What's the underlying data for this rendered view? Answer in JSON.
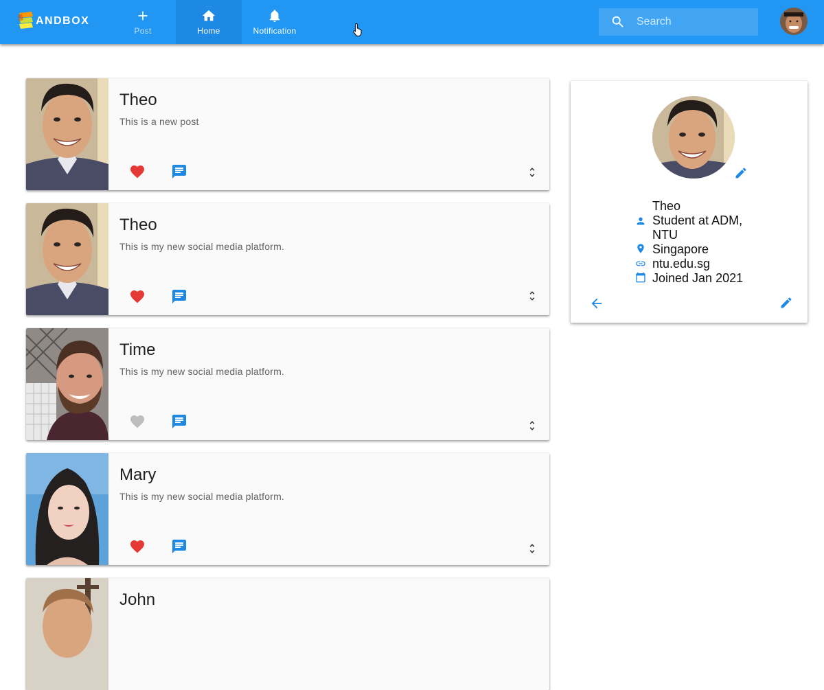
{
  "app": {
    "logo_text": "ANDBOX",
    "nav": [
      {
        "label": "Post",
        "icon": "plus-icon"
      },
      {
        "label": "Home",
        "icon": "home-icon",
        "active": true
      },
      {
        "label": "Notification",
        "icon": "bell-icon"
      }
    ],
    "search": {
      "placeholder": "Search"
    },
    "colors": {
      "primary": "#2196f3",
      "active_tab": "#1e88e5",
      "like": "#e53935",
      "like_off": "#bdbdbd"
    }
  },
  "posts": [
    {
      "name": "Theo",
      "text": "This is a new post",
      "liked": true
    },
    {
      "name": "Theo",
      "text": "This is my new social media platform.",
      "liked": true
    },
    {
      "name": "Time",
      "text": "This is my new social media platform.",
      "liked": false
    },
    {
      "name": "Mary",
      "text": "This is my new social media platform.",
      "liked": true
    },
    {
      "name": "John",
      "text": "",
      "liked": false
    }
  ],
  "profile": {
    "name": "Theo",
    "bio_line1": "Student at ADM,",
    "bio_line2": "NTU",
    "location": "Singapore",
    "website": "ntu.edu.sg",
    "joined": "Joined Jan 2021"
  }
}
